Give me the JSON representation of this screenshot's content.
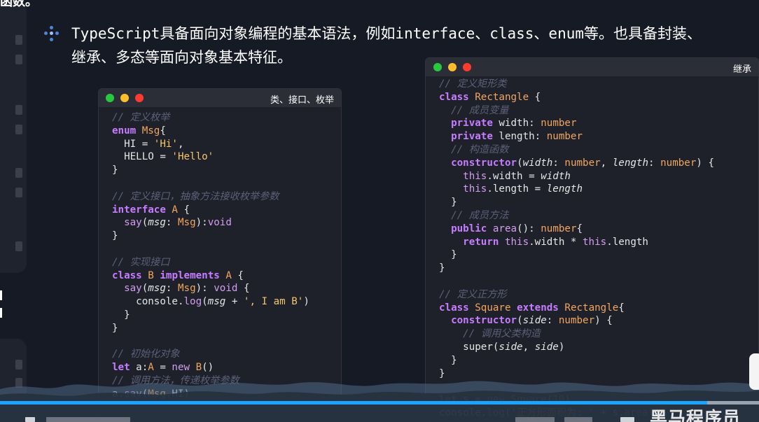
{
  "slide": {
    "top_fragment": "函数。",
    "intro_line1": "TypeScript具备面向对象编程的基本语法，例如interface、class、enum等。也具备封装、",
    "intro_line2": "继承、多态等面向对象基本特征。"
  },
  "left_window": {
    "title": "类、接口、枚举"
  },
  "right_window": {
    "title": "继承"
  },
  "watermark": {
    "text": "黑马程序员"
  },
  "colors": {
    "background": "#161a24",
    "window_bg": "#1e212a",
    "keyword": "#c77dff",
    "comment": "#5b6078",
    "string": "#f5c66a",
    "type": "#f2a65e",
    "progress": "#1ba3ff"
  },
  "icons": {
    "bullet": "sparkle-bullet-icon",
    "window_controls": [
      "close-dot-green",
      "minimize-dot-yellow",
      "zoom-dot-red"
    ]
  }
}
